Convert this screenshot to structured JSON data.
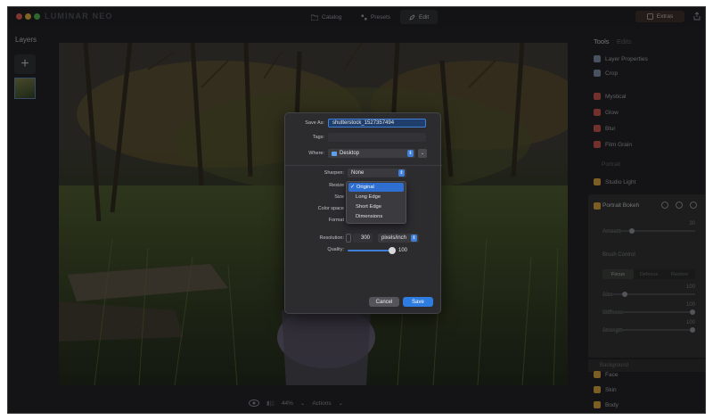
{
  "titlebar": {
    "app_name": "LUMINAR NEO",
    "tabs": [
      {
        "label": "Catalog",
        "icon": "folder-icon"
      },
      {
        "label": "Presets",
        "icon": "presets-icon"
      },
      {
        "label": "Edit",
        "icon": "edit-icon"
      }
    ],
    "extras_label": "Extras"
  },
  "left_panel": {
    "title": "Layers",
    "add_label": "+"
  },
  "bottom_bar": {
    "zoom": "44%",
    "actions_label": "Actions"
  },
  "right_panel": {
    "tab_tools": "Tools",
    "tab_edits": "Edits",
    "items_top": [
      {
        "label": "Layer Properties",
        "icon": "layers-icon",
        "color": "#7b8aa6"
      },
      {
        "label": "Crop",
        "icon": "crop-icon",
        "color": "#7b8aa6"
      }
    ],
    "items_creative": [
      {
        "label": "Mystical",
        "icon": "mystical-icon",
        "color": "#c8504a"
      },
      {
        "label": "Glow",
        "icon": "glow-icon",
        "color": "#c8504a"
      },
      {
        "label": "Blur",
        "icon": "blur-icon",
        "color": "#c8504a"
      },
      {
        "label": "Film Grain",
        "icon": "film-grain-icon",
        "color": "#c8504a"
      }
    ],
    "portrait_section": "Portrait",
    "studio_light": "Studio Light",
    "bokeh": {
      "title": "Portrait Bokeh",
      "amount_label": "Amount",
      "amount_value": "30",
      "brush_control": "Brush Control",
      "segments": [
        "Focus",
        "Defocus",
        "Restore"
      ],
      "size_label": "Size",
      "size_value": "100",
      "stiffness_label": "Stiffness",
      "stiffness_value": "100",
      "strength_label": "Strength",
      "strength_value": "100",
      "background_label": "Background"
    },
    "items_bottom": [
      {
        "label": "Face",
        "icon": "face-icon",
        "color": "#d9a23a"
      },
      {
        "label": "Skin",
        "icon": "skin-icon",
        "color": "#d9a23a"
      },
      {
        "label": "Body",
        "icon": "body-icon",
        "color": "#d9a23a"
      }
    ]
  },
  "save_dialog": {
    "save_as_label": "Save As:",
    "save_as_value": "shutterstock_1527357494",
    "tags_label": "Tags:",
    "where_label": "Where:",
    "where_value": "Desktop",
    "sharpen_label": "Sharpen:",
    "sharpen_value": "None",
    "resize_label": "Resize",
    "size_label": "Size",
    "color_space_label": "Color space",
    "format_label": "Format",
    "resize_options": [
      "Original",
      "Long Edge",
      "Short Edge",
      "Dimensions"
    ],
    "resize_selected": "Original",
    "resolution_label": "Resolution:",
    "resolution_value": "300",
    "resolution_unit": "pixels/inch",
    "quality_label": "Quality:",
    "quality_value": "100",
    "cancel_label": "Cancel",
    "save_label": "Save"
  },
  "colors": {
    "accent": "#2f7ce0",
    "window_bg": "#1c1d20"
  }
}
